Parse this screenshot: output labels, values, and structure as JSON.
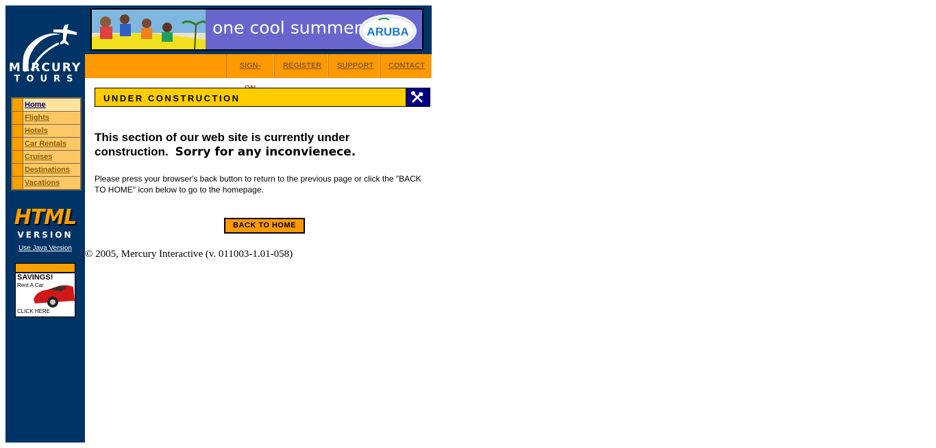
{
  "logo": {
    "line1": "MERCURY",
    "line2": "TOURS"
  },
  "sidebar": {
    "nav": [
      {
        "label": "Home"
      },
      {
        "label": "Flights"
      },
      {
        "label": "Hotels"
      },
      {
        "label": "Car Rentals"
      },
      {
        "label": "Cruises"
      },
      {
        "label": "Destinations"
      },
      {
        "label": "Vacations"
      }
    ],
    "html_version": {
      "title": "HTML",
      "subtitle": "VERSION"
    },
    "java_link": "Use Java Version",
    "ad": {
      "headline": "SAVINGS!",
      "subline": "Rent A Car",
      "cta": "CLICK HERE"
    }
  },
  "banner": {
    "text": "one cool summer",
    "brand": "ARUBA"
  },
  "top_nav": [
    {
      "label": "SIGN-ON"
    },
    {
      "label": "REGISTER"
    },
    {
      "label": "SUPPORT"
    },
    {
      "label": "CONTACT"
    }
  ],
  "main": {
    "section_title": "UNDER CONSTRUCTION",
    "heading_part1": "This section of our web site is currently under construction.",
    "heading_part2": "Sorry for any inconvienece.",
    "body": "Please press your browser's back button to return to the previous page or click the \"BACK TO HOME\" icon below to go to the homepage.",
    "back_button": "BACK TO HOME",
    "copyright": "© 2005, Mercury Interactive (v. 011003-1.01-058)"
  },
  "colors": {
    "sidebar": "#003366",
    "accent_orange": "#ff9900",
    "banner_purple": "#6666cc",
    "construction_yellow": "#ffcc00"
  },
  "icons": [
    "plane-logo-icon",
    "tools-icon",
    "car-icon"
  ]
}
